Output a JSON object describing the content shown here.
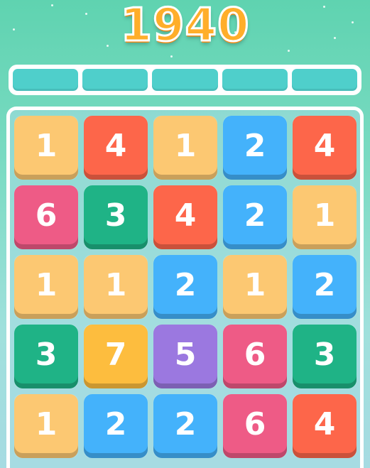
{
  "score": "1940",
  "progress_segments": 5,
  "colors": {
    "1": "#fcc872",
    "2": "#44b2fb",
    "3": "#1fb386",
    "4": "#fd664a",
    "5": "#9b78e0",
    "6": "#ee5b86",
    "7": "#fdbd3e"
  },
  "board": [
    [
      "1",
      "4",
      "1",
      "2",
      "4"
    ],
    [
      "6",
      "3",
      "4",
      "2",
      "1"
    ],
    [
      "1",
      "1",
      "2",
      "1",
      "2"
    ],
    [
      "3",
      "7",
      "5",
      "6",
      "3"
    ],
    [
      "1",
      "2",
      "2",
      "6",
      "4"
    ]
  ]
}
